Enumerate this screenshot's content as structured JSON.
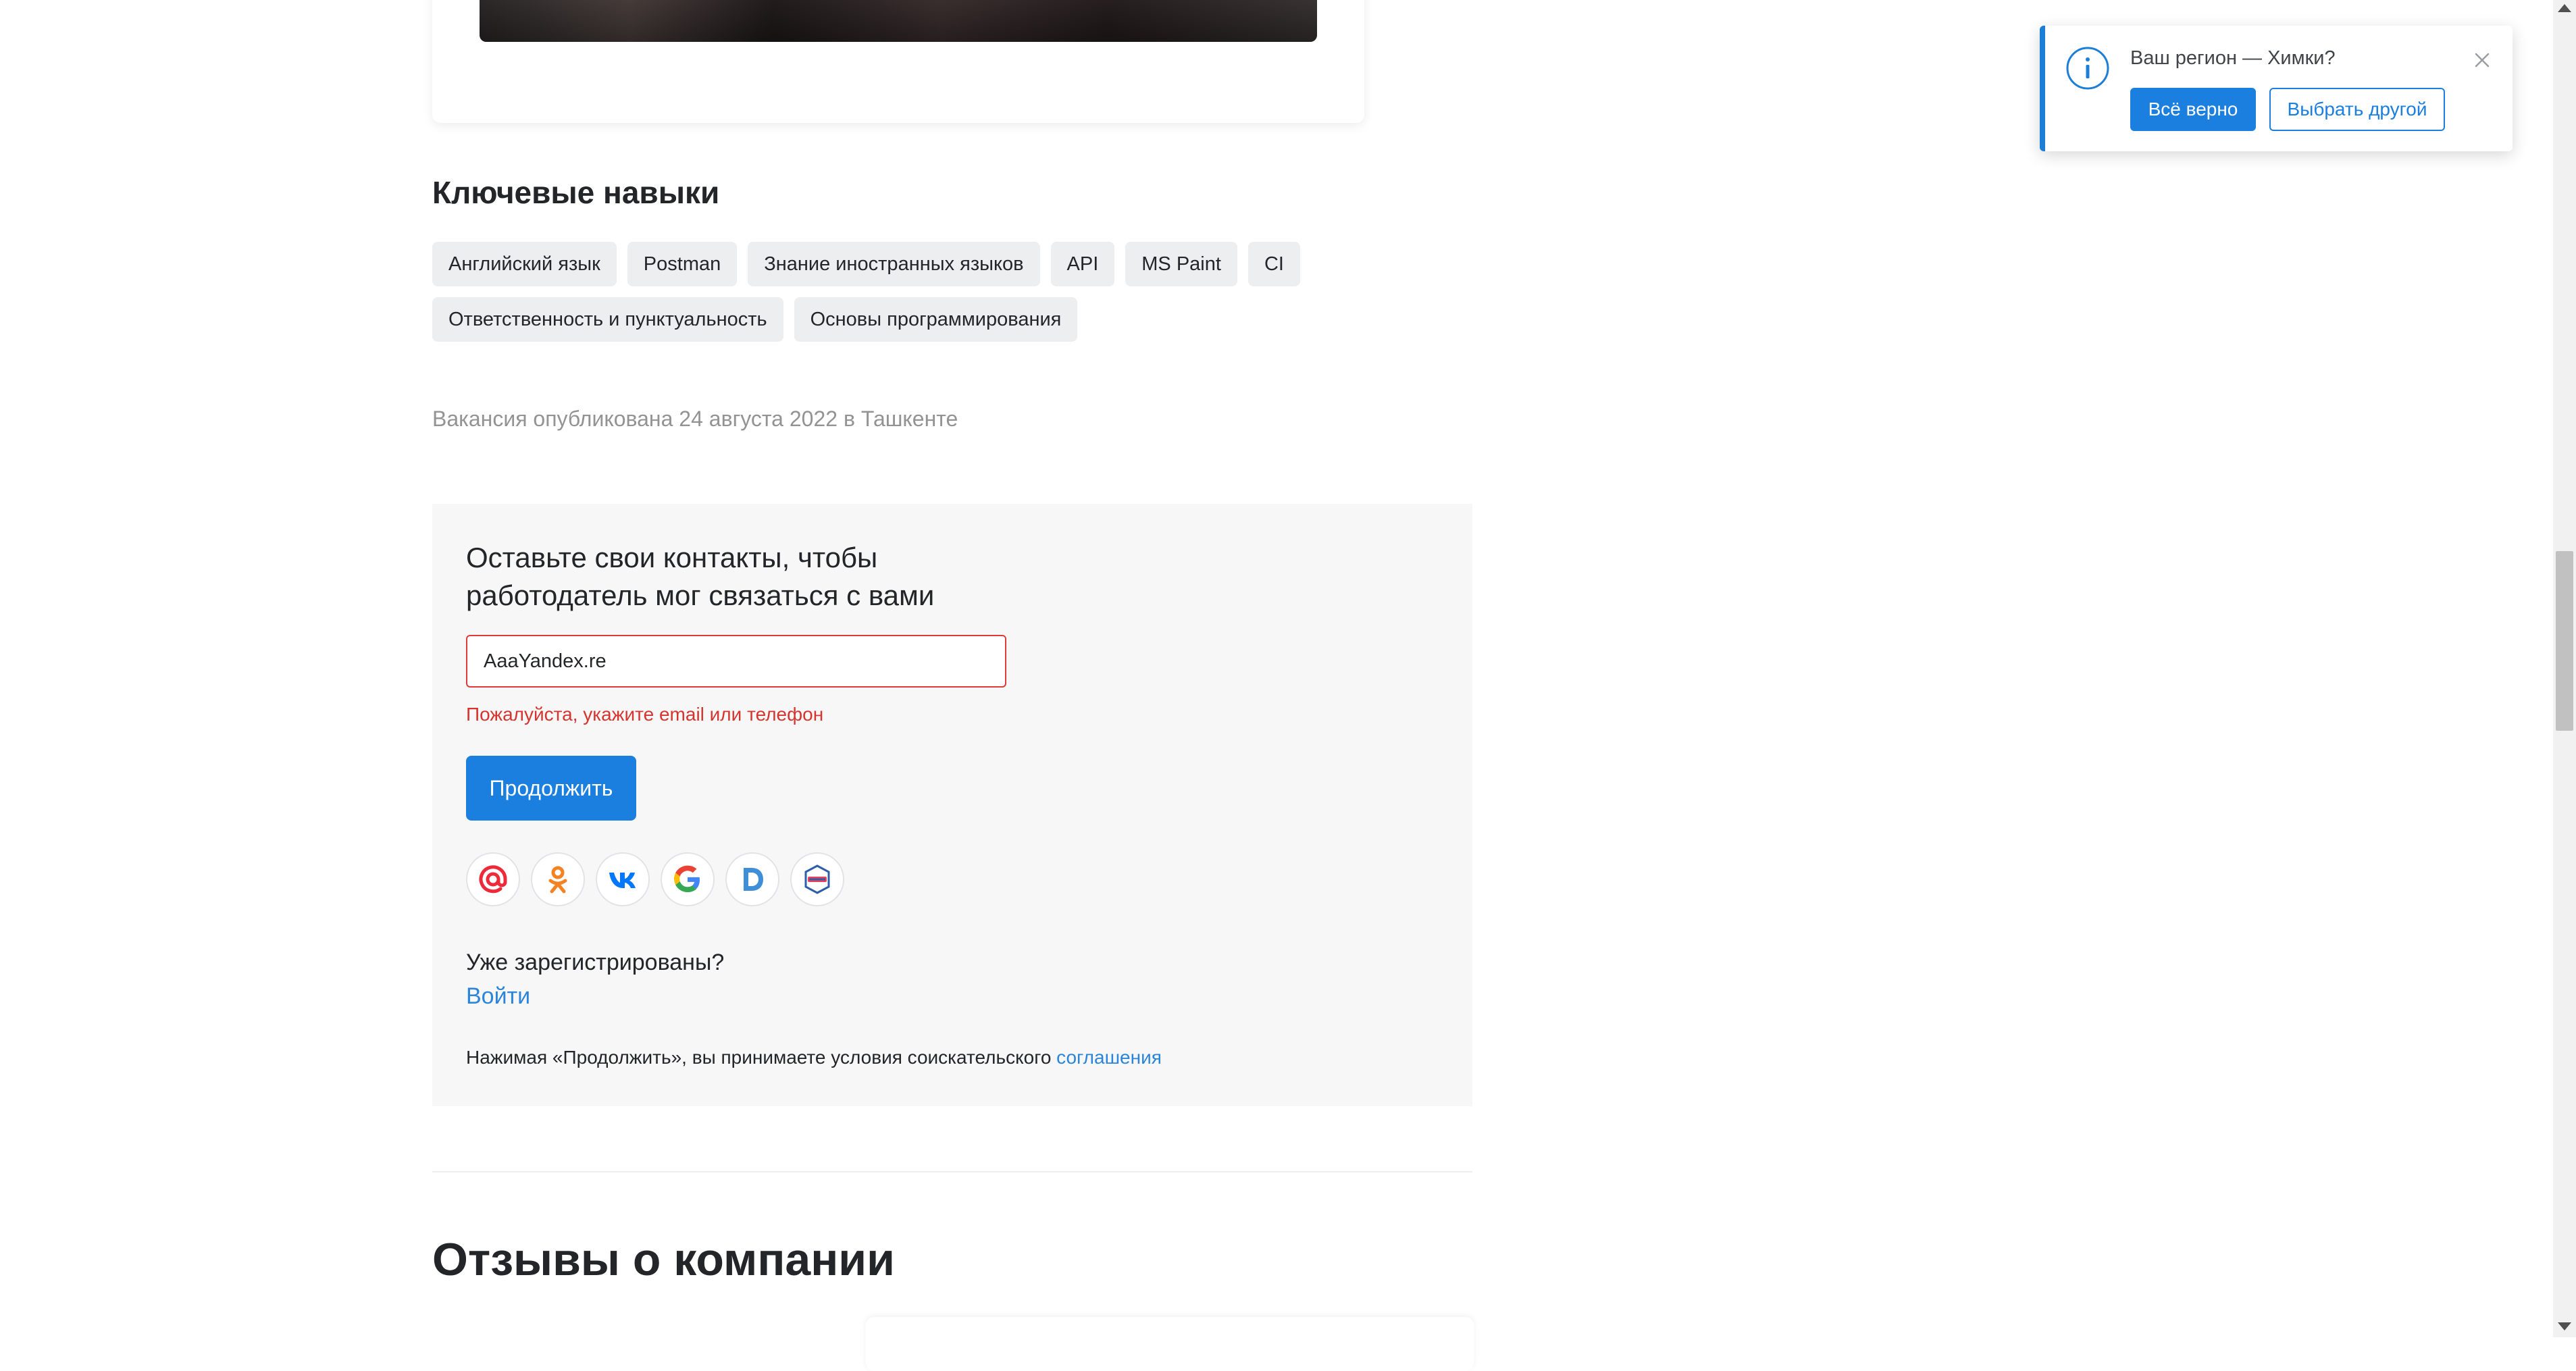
{
  "skills": {
    "title": "Ключевые навыки",
    "items": [
      "Английский язык",
      "Postman",
      "Знание иностранных языков",
      "API",
      "MS Paint",
      "CI",
      "Ответственность и пунктуальность",
      "Основы программирования"
    ]
  },
  "published": "Вакансия опубликована 24 августа 2022 в Ташкенте",
  "contact_form": {
    "title_line1": "Оставьте свои контакты, чтобы",
    "title_line2": "работодатель мог связаться с вами",
    "input_value": "AaaYandex.re",
    "error": "Пожалуйста, укажите email или телефон",
    "continue_label": "Продолжить",
    "socials": [
      "mail-ru-icon",
      "odnoklassniki-icon",
      "vk-icon",
      "google-icon",
      "d-icon",
      "gosuslugi-icon"
    ],
    "registered_text": "Уже зарегистрированы?",
    "login_label": "Войти",
    "agreement_text": "Нажимая «Продолжить», вы принимаете условия соискательского ",
    "agreement_link": "соглашения"
  },
  "reviews": {
    "title": "Отзывы о компании"
  },
  "region_popup": {
    "text": "Ваш регион — Химки?",
    "confirm_label": "Всё верно",
    "other_label": "Выбрать другой"
  },
  "colors": {
    "accent": "#1b7fe0",
    "error": "#d6352f",
    "link": "#2b86d9",
    "form_bg": "#f7f7f7",
    "skill_bg": "#eceef0"
  }
}
